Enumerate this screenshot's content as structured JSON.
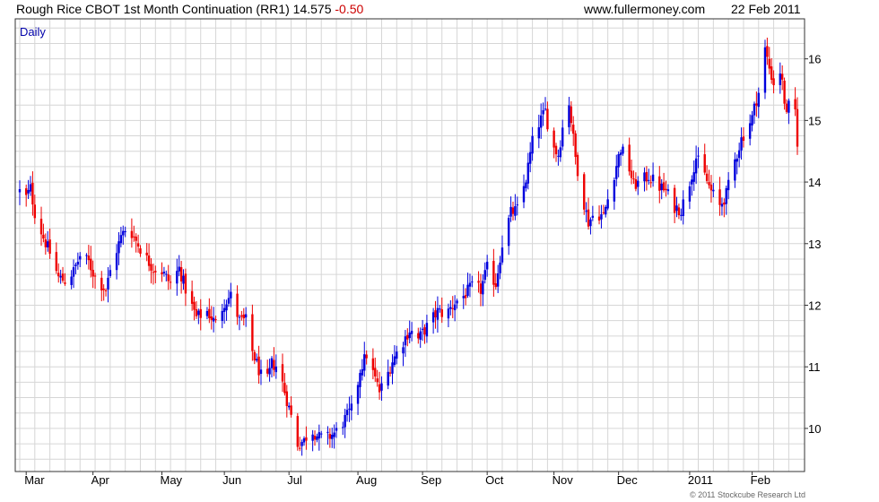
{
  "header": {
    "title": "Rough Rice CBOT 1st Month Continuation (RR1)",
    "last": "14.575",
    "change": "-0.50",
    "site": "www.fullermoney.com",
    "date": "22 Feb 2011"
  },
  "footer": {
    "copyright": "© 2011 Stockcube Research Ltd"
  },
  "colors": {
    "up": "#0000dd",
    "down": "#ee0000",
    "grid": "#d6d6d6",
    "frame": "#333333",
    "label": "#0000aa"
  },
  "chart_data": {
    "type": "ohlc",
    "period_label": "Daily",
    "x_range": [
      "2010-02-26",
      "2011-02-22"
    ],
    "ylim": [
      9.3,
      16.65
    ],
    "yticks": [
      10,
      11,
      12,
      13,
      14,
      15,
      16
    ],
    "month_labels": [
      {
        "label": "Mar",
        "date": "2010-03-01"
      },
      {
        "label": "Apr",
        "date": "2010-04-01"
      },
      {
        "label": "May",
        "date": "2010-05-03"
      },
      {
        "label": "Jun",
        "date": "2010-06-01"
      },
      {
        "label": "Jul",
        "date": "2010-07-01"
      },
      {
        "label": "Aug",
        "date": "2010-08-02"
      },
      {
        "label": "Sep",
        "date": "2010-09-01"
      },
      {
        "label": "Oct",
        "date": "2010-10-01"
      },
      {
        "label": "Nov",
        "date": "2010-11-01"
      },
      {
        "label": "Dec",
        "date": "2010-12-01"
      },
      {
        "label": "2011",
        "date": "2011-01-03"
      },
      {
        "label": "Feb",
        "date": "2011-02-01"
      }
    ],
    "close_path": [
      [
        "2010-02-26",
        13.85
      ],
      [
        "2010-03-01",
        13.75
      ],
      [
        "2010-03-03",
        13.9
      ],
      [
        "2010-03-05",
        13.5
      ],
      [
        "2010-03-09",
        13.1
      ],
      [
        "2010-03-12",
        12.85
      ],
      [
        "2010-03-16",
        12.45
      ],
      [
        "2010-03-19",
        12.4
      ],
      [
        "2010-03-23",
        12.55
      ],
      [
        "2010-03-26",
        12.8
      ],
      [
        "2010-03-30",
        12.7
      ],
      [
        "2010-04-02",
        12.45
      ],
      [
        "2010-04-07",
        12.25
      ],
      [
        "2010-04-10",
        12.7
      ],
      [
        "2010-04-14",
        13.1
      ],
      [
        "2010-04-17",
        13.3
      ],
      [
        "2010-04-21",
        13.05
      ],
      [
        "2010-04-25",
        12.8
      ],
      [
        "2010-04-29",
        12.6
      ],
      [
        "2010-05-03",
        12.55
      ],
      [
        "2010-05-07",
        12.35
      ],
      [
        "2010-05-11",
        12.6
      ],
      [
        "2010-05-15",
        12.15
      ],
      [
        "2010-05-19",
        11.8
      ],
      [
        "2010-05-24",
        11.9
      ],
      [
        "2010-05-28",
        11.7
      ],
      [
        "2010-06-01",
        12.05
      ],
      [
        "2010-06-04",
        12.15
      ],
      [
        "2010-06-08",
        11.75
      ],
      [
        "2010-06-11",
        11.75
      ],
      [
        "2010-06-14",
        11.25
      ],
      [
        "2010-06-17",
        10.95
      ],
      [
        "2010-06-20",
        10.65
      ],
      [
        "2010-06-23",
        11.05
      ],
      [
        "2010-06-26",
        11.0
      ],
      [
        "2010-06-29",
        10.6
      ],
      [
        "2010-07-02",
        10.2
      ],
      [
        "2010-07-05",
        9.75
      ],
      [
        "2010-07-08",
        9.8
      ],
      [
        "2010-07-11",
        10.0
      ],
      [
        "2010-07-15",
        9.85
      ],
      [
        "2010-07-19",
        9.85
      ],
      [
        "2010-07-23",
        9.95
      ],
      [
        "2010-07-27",
        10.15
      ],
      [
        "2010-07-31",
        10.35
      ],
      [
        "2010-08-03",
        10.95
      ],
      [
        "2010-08-06",
        11.2
      ],
      [
        "2010-08-09",
        10.9
      ],
      [
        "2010-08-12",
        10.6
      ],
      [
        "2010-08-15",
        10.8
      ],
      [
        "2010-08-18",
        11.1
      ],
      [
        "2010-08-22",
        11.35
      ],
      [
        "2010-08-26",
        11.6
      ],
      [
        "2010-08-30",
        11.45
      ],
      [
        "2010-09-03",
        11.65
      ],
      [
        "2010-09-08",
        11.9
      ],
      [
        "2010-09-12",
        11.85
      ],
      [
        "2010-09-16",
        12.05
      ],
      [
        "2010-09-20",
        12.15
      ],
      [
        "2010-09-24",
        12.3
      ],
      [
        "2010-09-28",
        12.25
      ],
      [
        "2010-10-01",
        12.6
      ],
      [
        "2010-10-05",
        12.35
      ],
      [
        "2010-10-08",
        13.0
      ],
      [
        "2010-10-12",
        13.5
      ],
      [
        "2010-10-15",
        13.55
      ],
      [
        "2010-10-19",
        14.05
      ],
      [
        "2010-10-22",
        14.65
      ],
      [
        "2010-10-25",
        14.95
      ],
      [
        "2010-10-28",
        15.15
      ],
      [
        "2010-10-31",
        14.6
      ],
      [
        "2010-11-03",
        14.45
      ],
      [
        "2010-11-06",
        15.1
      ],
      [
        "2010-11-08",
        15.3
      ],
      [
        "2010-11-11",
        14.4
      ],
      [
        "2010-11-14",
        13.8
      ],
      [
        "2010-11-17",
        13.35
      ],
      [
        "2010-11-20",
        13.5
      ],
      [
        "2010-11-24",
        13.45
      ],
      [
        "2010-11-28",
        14.0
      ],
      [
        "2010-12-02",
        14.55
      ],
      [
        "2010-12-05",
        14.35
      ],
      [
        "2010-12-08",
        13.95
      ],
      [
        "2010-12-11",
        14.0
      ],
      [
        "2010-12-15",
        14.1
      ],
      [
        "2010-12-19",
        13.95
      ],
      [
        "2010-12-23",
        13.85
      ],
      [
        "2010-12-27",
        13.6
      ],
      [
        "2010-12-30",
        13.55
      ],
      [
        "2011-01-03",
        14.0
      ],
      [
        "2011-01-06",
        14.4
      ],
      [
        "2011-01-10",
        14.1
      ],
      [
        "2011-01-13",
        13.85
      ],
      [
        "2011-01-17",
        13.6
      ],
      [
        "2011-01-20",
        13.8
      ],
      [
        "2011-01-24",
        14.35
      ],
      [
        "2011-01-27",
        14.7
      ],
      [
        "2011-01-30",
        14.9
      ],
      [
        "2011-02-01",
        15.05
      ],
      [
        "2011-02-03",
        15.35
      ],
      [
        "2011-02-05",
        15.55
      ],
      [
        "2011-02-07",
        16.15
      ],
      [
        "2011-02-09",
        15.85
      ],
      [
        "2011-02-11",
        15.6
      ],
      [
        "2011-02-13",
        16.0
      ],
      [
        "2011-02-15",
        15.6
      ],
      [
        "2011-02-17",
        15.05
      ],
      [
        "2011-02-19",
        15.4
      ],
      [
        "2011-02-21",
        15.15
      ],
      [
        "2011-02-22",
        14.575
      ]
    ]
  }
}
